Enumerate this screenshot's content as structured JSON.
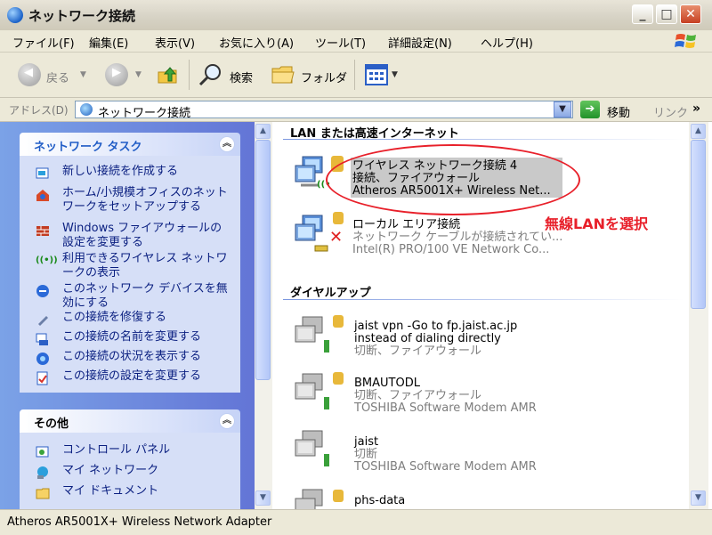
{
  "window": {
    "title": "ネットワーク接続",
    "min_label": "_",
    "max_label": "□",
    "close_label": "✕"
  },
  "menu": [
    "ファイル(F)",
    "編集(E)",
    "表示(V)",
    "お気に入り(A)",
    "ツール(T)",
    "詳細設定(N)",
    "ヘルプ(H)"
  ],
  "toolbar": {
    "back_label": "戻る",
    "search_label": "検索",
    "folder_label": "フォルダ"
  },
  "address": {
    "label": "アドレス(D)",
    "value": "ネットワーク接続",
    "go_label": "移動",
    "links_label": "リンク",
    "more": "»"
  },
  "network_tasks": {
    "title": "ネットワーク タスク",
    "items": [
      {
        "label": "新しい接続を作成する",
        "icon": "new-connection-icon"
      },
      {
        "label": "ホーム/小規模オフィスのネットワークをセットアップする",
        "icon": "home-network-icon"
      },
      {
        "label": "Windows ファイアウォールの設定を変更する",
        "icon": "firewall-icon"
      },
      {
        "label": "利用できるワイヤレス ネットワークの表示",
        "icon": "wireless-icon"
      },
      {
        "label": "このネットワーク デバイスを無効にする",
        "icon": "disable-device-icon"
      },
      {
        "label": "この接続を修復する",
        "icon": "repair-icon"
      },
      {
        "label": "この接続の名前を変更する",
        "icon": "rename-icon"
      },
      {
        "label": "この接続の状況を表示する",
        "icon": "status-icon"
      },
      {
        "label": "この接続の設定を変更する",
        "icon": "settings-icon"
      }
    ]
  },
  "other": {
    "title": "その他",
    "items": [
      {
        "label": "コントロール パネル",
        "icon": "control-panel-icon"
      },
      {
        "label": "マイ ネットワーク",
        "icon": "my-network-icon"
      },
      {
        "label": "マイ ドキュメント",
        "icon": "my-documents-icon"
      }
    ]
  },
  "lan_group": {
    "title": "LAN または高速インターネット",
    "connections": [
      {
        "name": "ワイヤレス ネットワーク接続 4",
        "status": "接続、ファイアウォール",
        "device": "Atheros AR5001X+ Wireless Net..."
      },
      {
        "name": "ローカル エリア接続",
        "status": "ネットワーク ケーブルが接続されてい...",
        "device": "Intel(R) PRO/100 VE Network Co..."
      }
    ]
  },
  "dialup_group": {
    "title": "ダイヤルアップ",
    "connections": [
      {
        "name": "jaist vpn -Go to fp.jaist.ac.jp",
        "name2": "instead of dialing directly",
        "status": "切断、ファイアウォール"
      },
      {
        "name": "BMAUTODL",
        "status": "切断、ファイアウォール",
        "device": "TOSHIBA Software Modem AMR"
      },
      {
        "name": "jaist",
        "status": "切断",
        "device": "TOSHIBA Software Modem AMR"
      },
      {
        "name": "phs-data"
      }
    ]
  },
  "annotation": "無線LANを選択",
  "statusbar": "Atheros AR5001X+ Wireless Network Adapter",
  "colors": {
    "accent": "#215dc6",
    "annotation": "#e8202a",
    "panel": "#6f8ce0"
  }
}
